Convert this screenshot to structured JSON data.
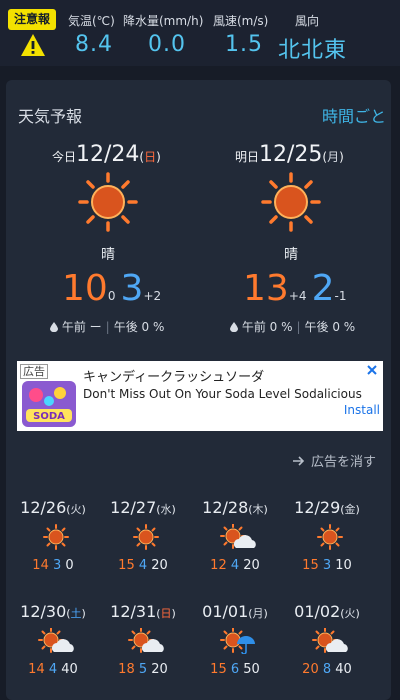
{
  "topbar": {
    "warning_badge": "注意報",
    "stats": [
      {
        "label": "気温(℃)",
        "value": "8.4"
      },
      {
        "label": "降水量(mm/h)",
        "value": "0.0"
      },
      {
        "label": "風速(m/s)",
        "value": "1.5"
      },
      {
        "label": "風向",
        "value": "北北東"
      }
    ]
  },
  "forecast": {
    "title": "天気予報",
    "hourly_link": "時間ごと",
    "days": [
      {
        "prefix": "今日",
        "date": "12/24",
        "weekday": "日",
        "weather": "晴",
        "icon": "sun-icon",
        "high": "10",
        "high_diff": "0",
        "low": "3",
        "low_diff": "+2",
        "rain_am": "午前 ー",
        "rain_pm": "午後 0 %"
      },
      {
        "prefix": "明日",
        "date": "12/25",
        "weekday": "月",
        "weather": "晴",
        "icon": "sun-icon",
        "high": "13",
        "high_diff": "+4",
        "low": "2",
        "low_diff": "-1",
        "rain_am": "午前 0 %",
        "rain_pm": "午後 0 %"
      }
    ]
  },
  "ad": {
    "tag": "広告",
    "title": "キャンディークラッシュソーダ",
    "description": "Don't Miss Out On Your Soda Level Sodalicious",
    "install": "Install",
    "hide_label": "広告を消す"
  },
  "weekly": [
    {
      "date": "12/26",
      "weekday": "火",
      "icon": "sun-icon",
      "high": "14",
      "low": "3",
      "precip": "0"
    },
    {
      "date": "12/27",
      "weekday": "水",
      "icon": "sun-icon",
      "high": "15",
      "low": "4",
      "precip": "20"
    },
    {
      "date": "12/28",
      "weekday": "木",
      "icon": "sun-cloud-icon",
      "high": "12",
      "low": "4",
      "precip": "20"
    },
    {
      "date": "12/29",
      "weekday": "金",
      "icon": "sun-icon",
      "high": "15",
      "low": "3",
      "precip": "10"
    },
    {
      "date": "12/30",
      "weekday": "土",
      "icon": "sun-cloud-icon",
      "high": "14",
      "low": "4",
      "precip": "40"
    },
    {
      "date": "12/31",
      "weekday": "日",
      "icon": "sun-cloud-icon",
      "high": "18",
      "low": "5",
      "precip": "20"
    },
    {
      "date": "01/01",
      "weekday": "月",
      "icon": "sun-umbrella-icon",
      "high": "15",
      "low": "6",
      "precip": "50"
    },
    {
      "date": "01/02",
      "weekday": "火",
      "icon": "sun-cloud-icon",
      "high": "20",
      "low": "8",
      "precip": "40"
    }
  ],
  "colors": {
    "background": "#171c27",
    "card": "#222a38",
    "high_temp": "#ff7a2e",
    "low_temp": "#4fa7f5",
    "accent": "#54c4ee",
    "warning": "#f3e100"
  }
}
